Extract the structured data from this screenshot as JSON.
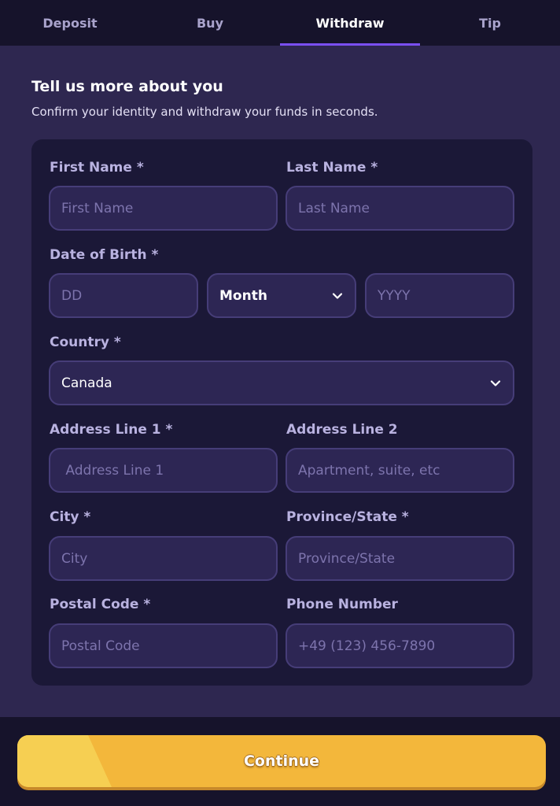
{
  "tabs": [
    {
      "label": "Deposit",
      "active": false
    },
    {
      "label": "Buy",
      "active": false
    },
    {
      "label": "Withdraw",
      "active": true
    },
    {
      "label": "Tip",
      "active": false
    }
  ],
  "intro": {
    "title": "Tell us more about you",
    "subtitle": "Confirm your identity and withdraw your funds in seconds."
  },
  "form": {
    "first_name": {
      "label": "First Name *",
      "placeholder": "First Name",
      "value": ""
    },
    "last_name": {
      "label": "Last Name *",
      "placeholder": "Last Name",
      "value": ""
    },
    "dob": {
      "label": "Date of Birth *",
      "day_placeholder": "DD",
      "month_value": "Month",
      "year_placeholder": "YYYY"
    },
    "country": {
      "label": "Country *",
      "value": "Canada"
    },
    "address1": {
      "label": "Address Line 1 *",
      "placeholder": " Address Line 1"
    },
    "address2": {
      "label": "Address Line 2",
      "placeholder": "Apartment, suite, etc"
    },
    "city": {
      "label": "City *",
      "placeholder": "City"
    },
    "province": {
      "label": "Province/State *",
      "placeholder": "Province/State"
    },
    "postal": {
      "label": "Postal Code *",
      "placeholder": "Postal Code"
    },
    "phone": {
      "label": "Phone Number",
      "placeholder": "+49 (123) 456-7890"
    }
  },
  "footer": {
    "continue_label": "Continue"
  },
  "colors": {
    "background": "#2e2750",
    "card": "#1b1837",
    "accent": "#7a4ff0",
    "button": "#f3b73b"
  },
  "icons": {
    "select_arrow": "chevron-down-icon"
  }
}
